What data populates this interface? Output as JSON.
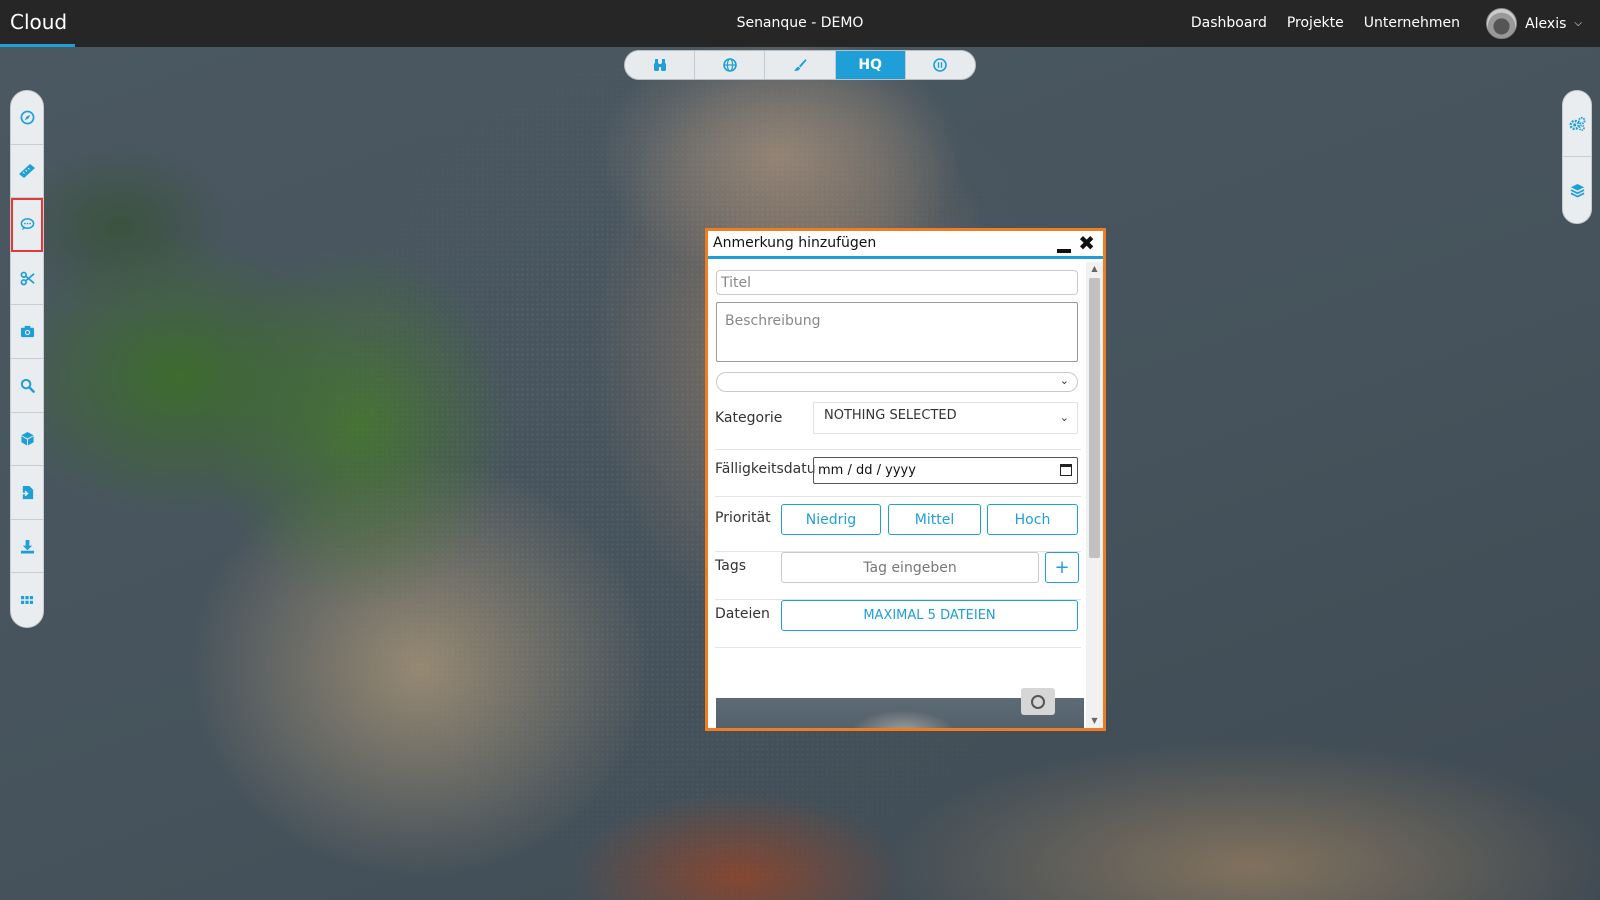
{
  "navbar": {
    "brand": "Cloud",
    "title": "Senanque - DEMO",
    "links": [
      "Dashboard",
      "Projekte",
      "Unternehmen"
    ],
    "user_name": "Alexis"
  },
  "top_toolbar": {
    "buttons": [
      {
        "icon": "binoculars-icon"
      },
      {
        "icon": "globe-icon"
      },
      {
        "icon": "brush-icon"
      },
      {
        "label": "HQ",
        "active": true
      },
      {
        "icon": "pause-circle-icon"
      }
    ]
  },
  "left_toolbar": {
    "buttons": [
      {
        "icon": "compass-icon"
      },
      {
        "icon": "ruler-icon"
      },
      {
        "icon": "comment-icon",
        "selected": true
      },
      {
        "icon": "scissors-icon"
      },
      {
        "icon": "camera-icon"
      },
      {
        "icon": "search-icon"
      },
      {
        "icon": "cube-icon"
      },
      {
        "icon": "file-import-icon"
      },
      {
        "icon": "download-icon"
      },
      {
        "icon": "grid-icon"
      }
    ]
  },
  "right_toolbar": {
    "buttons": [
      {
        "icon": "settings-gears-icon"
      },
      {
        "icon": "layers-icon"
      }
    ]
  },
  "dialog": {
    "title": "Anmerkung hinzufügen",
    "title_placeholder": "Titel",
    "description_placeholder": "Beschreibung",
    "category_label": "Kategorie",
    "category_value": "NOTHING SELECTED",
    "due_date_label": "Fälligkeitsdatum",
    "due_date_value": "mm / dd / yyyy",
    "priority_label": "Priorität",
    "priority_options": [
      "Niedrig",
      "Mittel",
      "Hoch"
    ],
    "tags_label": "Tags",
    "tags_placeholder": "Tag eingeben",
    "tags_add": "+",
    "files_label": "Dateien",
    "files_button": "MAXIMAL 5 DATEIEN"
  },
  "colors": {
    "accent": "#1f9fd8",
    "dialog_border": "#ef7d22",
    "navbar_bg": "#262626",
    "selected_tool_outline": "#e53935"
  }
}
